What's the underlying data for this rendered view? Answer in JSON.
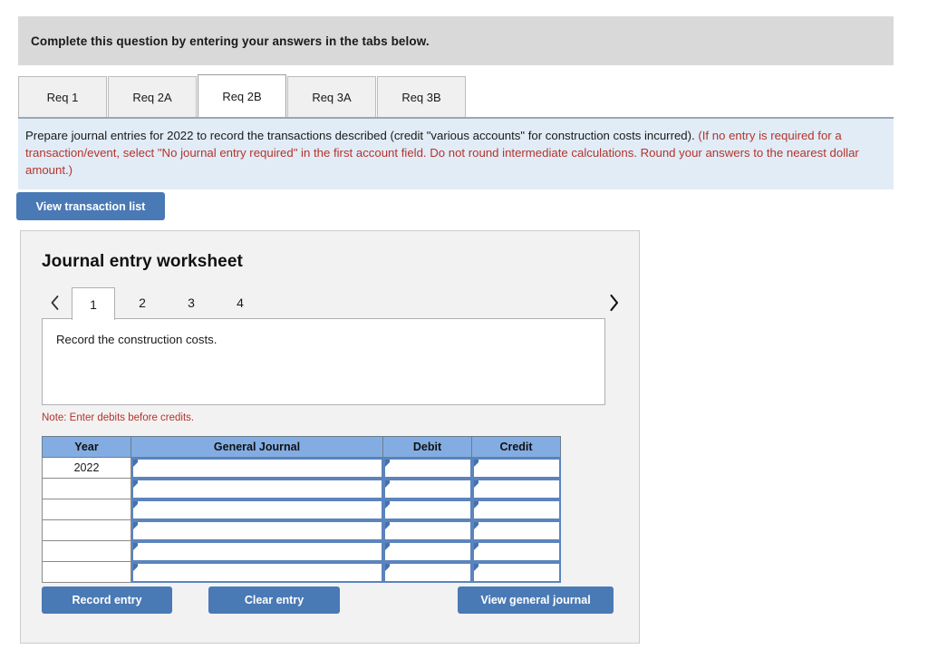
{
  "banner": {
    "text": "Complete this question by entering your answers in the tabs below."
  },
  "tabs": [
    {
      "label": "Req 1",
      "active": false
    },
    {
      "label": "Req 2A",
      "active": false
    },
    {
      "label": "Req 2B",
      "active": true
    },
    {
      "label": "Req 3A",
      "active": false
    },
    {
      "label": "Req 3B",
      "active": false
    }
  ],
  "instruction": {
    "black_text": "Prepare journal entries for 2022 to record the transactions described (credit \"various accounts\" for construction costs incurred).",
    "red_text": "(If no entry is required for a transaction/event, select \"No journal entry required\" in the first account field. Do not round intermediate calculations. Round your answers to the nearest dollar amount.)"
  },
  "toolbar": {
    "view_transaction_list_label": "View transaction list"
  },
  "worksheet": {
    "title": "Journal entry worksheet",
    "pager": {
      "prev_icon": "chevron-left-icon",
      "next_icon": "chevron-right-icon",
      "pages": [
        {
          "label": "1",
          "active": true
        },
        {
          "label": "2",
          "active": false
        },
        {
          "label": "3",
          "active": false
        },
        {
          "label": "4",
          "active": false
        }
      ]
    },
    "description": "Record the construction costs.",
    "note": "Note: Enter debits before credits.",
    "table": {
      "headers": [
        "Year",
        "General Journal",
        "Debit",
        "Credit"
      ],
      "rows": [
        {
          "year": "2022",
          "general_journal": "",
          "debit": "",
          "credit": ""
        },
        {
          "year": "",
          "general_journal": "",
          "debit": "",
          "credit": ""
        },
        {
          "year": "",
          "general_journal": "",
          "debit": "",
          "credit": ""
        },
        {
          "year": "",
          "general_journal": "",
          "debit": "",
          "credit": ""
        },
        {
          "year": "",
          "general_journal": "",
          "debit": "",
          "credit": ""
        },
        {
          "year": "",
          "general_journal": "",
          "debit": "",
          "credit": ""
        }
      ]
    },
    "buttons": {
      "record_entry": "Record entry",
      "clear_entry": "Clear entry",
      "view_general_journal": "View general journal"
    }
  },
  "colors": {
    "banner_gray": "#d9d9d9",
    "instruction_blue": "#e1ecf7",
    "red_text": "#b5342a",
    "button_blue": "#4a7ab5",
    "table_header_blue": "#83ade2",
    "panel_gray": "#f2f2f2",
    "input_border_blue": "#5b84bd"
  }
}
